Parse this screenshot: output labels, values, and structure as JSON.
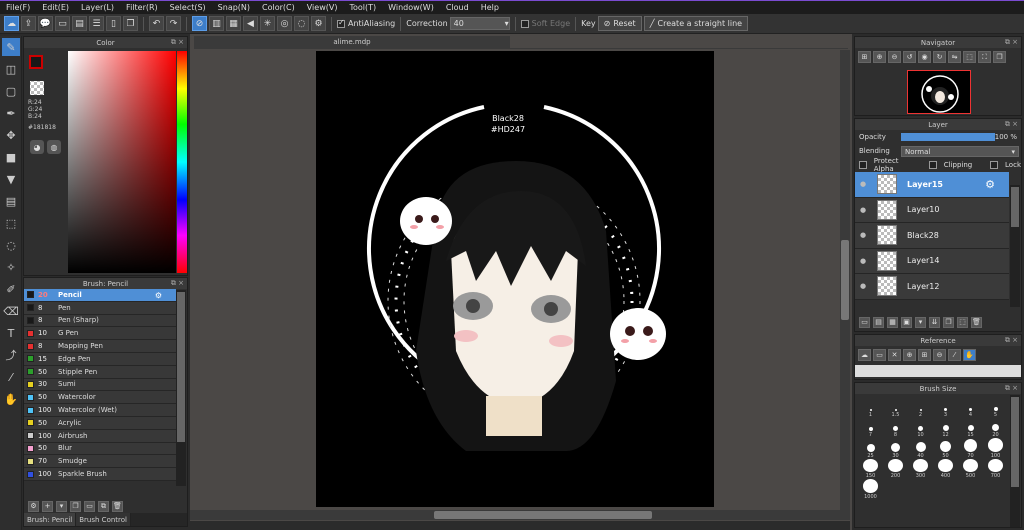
{
  "menu": [
    "File(F)",
    "Edit(E)",
    "Layer(L)",
    "Filter(R)",
    "Select(S)",
    "Snap(N)",
    "Color(C)",
    "View(V)",
    "Tool(T)",
    "Window(W)",
    "Cloud",
    "Help"
  ],
  "toolbar": {
    "antialiasing_label": "AntiAliasing",
    "correction_label": "Correction",
    "correction_value": "40",
    "soft_edge_label": "Soft Edge",
    "key_label": "Key",
    "reset_label": "Reset",
    "straight_line_label": "Create a straight line"
  },
  "color_panel": {
    "title": "Color",
    "r": "R:24",
    "g": "G:24",
    "b": "B:24",
    "hex": "#181818",
    "current_color": "#181818"
  },
  "brush_panel": {
    "title": "Brush: Pencil",
    "brushes": [
      {
        "size": "20",
        "name": "Pencil",
        "color": "#181818",
        "selected": true
      },
      {
        "size": "8",
        "name": "Pen",
        "color": "#181818"
      },
      {
        "size": "8",
        "name": "Pen (Sharp)",
        "color": "#181818"
      },
      {
        "size": "10",
        "name": "G Pen",
        "color": "#e63030"
      },
      {
        "size": "8",
        "name": "Mapping Pen",
        "color": "#e63030"
      },
      {
        "size": "15",
        "name": "Edge Pen",
        "color": "#2ca02c"
      },
      {
        "size": "50",
        "name": "Stipple Pen",
        "color": "#2ca02c"
      },
      {
        "size": "30",
        "name": "Sumi",
        "color": "#e6d020"
      },
      {
        "size": "50",
        "name": "Watercolor",
        "color": "#4fc3f7"
      },
      {
        "size": "100",
        "name": "Watercolor (Wet)",
        "color": "#4fc3f7"
      },
      {
        "size": "50",
        "name": "Acrylic",
        "color": "#e6d020"
      },
      {
        "size": "100",
        "name": "Airbrush",
        "color": "#cccccc"
      },
      {
        "size": "50",
        "name": "Blur",
        "color": "#f5a0d0"
      },
      {
        "size": "70",
        "name": "Smudge",
        "color": "#e6e080"
      },
      {
        "size": "100",
        "name": "Sparkle Brush",
        "color": "#3050e0"
      }
    ],
    "tabs": [
      "Brush: Pencil",
      "Brush Control"
    ]
  },
  "canvas": {
    "doc_tab": "alime.mdp",
    "label_name": "Black28",
    "label_hex": "#HD247"
  },
  "navigator": {
    "title": "Navigator"
  },
  "layer_panel": {
    "title": "Layer",
    "opacity_label": "Opacity",
    "opacity_value": "100 %",
    "opacity_fraction": 1.0,
    "blending_label": "Blending",
    "blending_value": "Normal",
    "protect_alpha": "Protect Alpha",
    "clipping": "Clipping",
    "lock": "Lock",
    "layers": [
      {
        "name": "Layer15",
        "selected": true
      },
      {
        "name": "Layer10"
      },
      {
        "name": "Black28"
      },
      {
        "name": "Layer14"
      },
      {
        "name": "Layer12"
      }
    ]
  },
  "reference": {
    "title": "Reference"
  },
  "brush_size": {
    "title": "Brush Size",
    "sizes": [
      "1",
      "1.5",
      "2",
      "3",
      "4",
      "5",
      "7",
      "8",
      "10",
      "12",
      "15",
      "20",
      "25",
      "30",
      "40",
      "50",
      "70",
      "100",
      "150",
      "200",
      "300",
      "400",
      "500",
      "700",
      "1000"
    ]
  }
}
